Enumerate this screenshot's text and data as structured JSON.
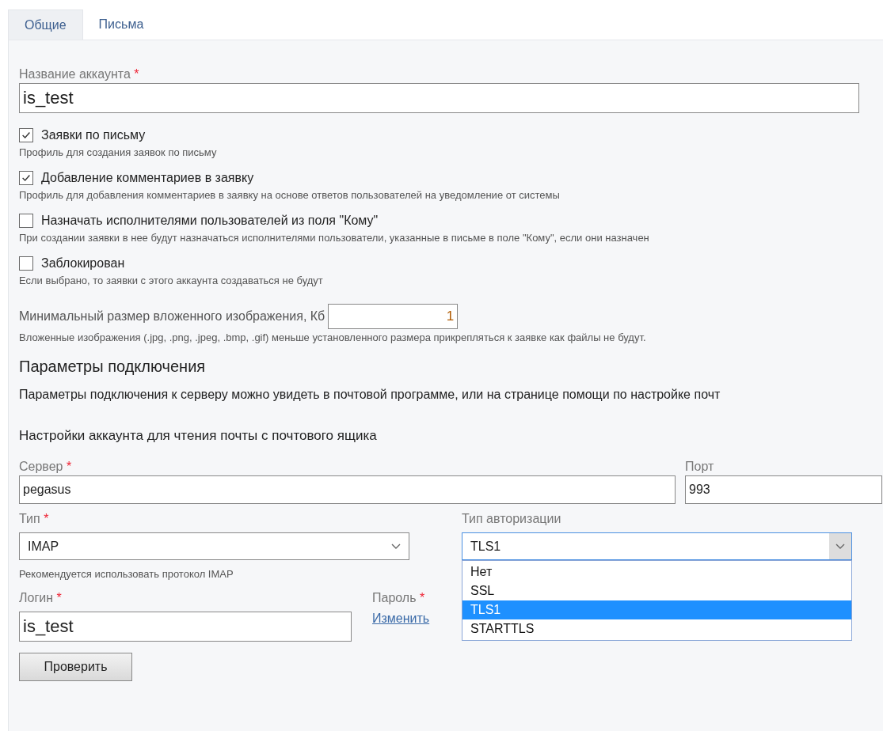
{
  "tabs": [
    {
      "label": "Общие",
      "selected": true
    },
    {
      "label": "Письма",
      "selected": false
    }
  ],
  "account_name": {
    "label": "Название аккаунта",
    "required_mark": "*",
    "value": "is_test"
  },
  "options": [
    {
      "label": "Заявки по письму",
      "description": "Профиль для создания заявок по письму",
      "checked": true
    },
    {
      "label": "Добавление комментариев в заявку",
      "description": "Профиль для добавления комментариев в заявку на основе ответов пользователей на уведомление от системы",
      "checked": true
    },
    {
      "label": "Назначать исполнителями пользователей из поля \"Кому\"",
      "description": "При создании заявки в нее будут назначаться исполнителями пользователи, указанные в письме в поле \"Кому\", если они назначен",
      "checked": false
    },
    {
      "label": "Заблокирован",
      "description": "Если выбрано, то заявки с этого аккаунта создаваться не будут",
      "checked": false
    }
  ],
  "min_image_size": {
    "label": "Минимальный размер вложенного изображения, Кб",
    "value": "1",
    "hint": "Вложенные изображения (.jpg, .png, .jpeg, .bmp, .gif) меньше установленного размера прикрепляться к заявке как файлы не будут."
  },
  "connection": {
    "heading": "Параметры подключения",
    "description": "Параметры подключения к серверу можно увидеть в почтовой программе, или на странице помощи по настройке почт"
  },
  "mailbox": {
    "heading": "Настройки аккаунта для чтения почты с почтового ящика",
    "server": {
      "label": "Сервер",
      "required_mark": "*",
      "value": "pegasus"
    },
    "port": {
      "label": "Порт",
      "value": "993"
    },
    "type": {
      "label": "Тип",
      "required_mark": "*",
      "value": "IMAP"
    },
    "type_hint": "Рекомендуется использовать протокол IMAP",
    "auth_type": {
      "label": "Тип авторизации",
      "value": "TLS1",
      "expanded": true,
      "options": [
        {
          "label": "Нет",
          "selected": false
        },
        {
          "label": "SSL",
          "selected": false
        },
        {
          "label": "TLS1",
          "selected": true
        },
        {
          "label": "STARTTLS",
          "selected": false
        }
      ]
    },
    "login": {
      "label": "Логин",
      "required_mark": "*",
      "value": "is_test"
    },
    "password": {
      "label": "Пароль",
      "required_mark": "*",
      "change_link": "Изменить"
    }
  },
  "check_button": "Проверить"
}
